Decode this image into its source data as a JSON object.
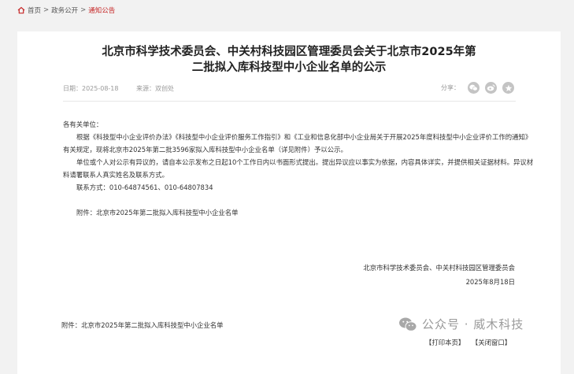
{
  "breadcrumb": {
    "items": [
      "首页",
      "政务公开",
      "通知公告"
    ],
    "separator": ">"
  },
  "article": {
    "title_line1": "北京市科学技术委员会、中关村科技园区管理委员会关于北京市2025年第",
    "title_line2": "二批拟入库科技型中小企业名单的公示",
    "date": "日期：2025-08-18",
    "source": "来源：双创处",
    "share_label": "分享：",
    "greeting": "各有关单位：",
    "para1": "根据《科技型中小企业评价办法》《科技型中小企业评价服务工作指引》和《工业和信息化部中小企业局关于开展2025年度科技型中小企业评价工作的通知》有关规定，现将北京市2025年第二批3596家拟入库科技型中小企业名单（详见附件）予以公示。",
    "para2": "单位或个人对公示有异议的，请自本公示发布之日起10个工作日内以书面形式提出。提出异议应以事实为依据，内容具体详实，并提供相关证据材料。异议材料请署联系人真实姓名及联系方式。",
    "contact": "联系方式：010-64874561、010-64807834",
    "attachment": "附件：北京市2025年第二批拟入库科技型中小企业名单",
    "signatory": "北京市科学技术委员会、中关村科技园区管理委员会",
    "sign_date": "2025年8月18日",
    "bottom_attachment": "附件：北京市2025年第二批拟入库科技型中小企业名单"
  },
  "watermark": "公众号 · 威木科技",
  "links": {
    "print": "【打印本页】",
    "close": "【关闭窗口】"
  },
  "colors": {
    "accent": "#c62828",
    "background": "#f2f2f2",
    "card": "#ffffff",
    "share_icon": "#c4c4c4"
  },
  "icons": {
    "home": "home-icon",
    "share": [
      "wechat-icon",
      "weibo-icon",
      "qzone-icon"
    ],
    "watermark": "wechat-logo-icon"
  }
}
